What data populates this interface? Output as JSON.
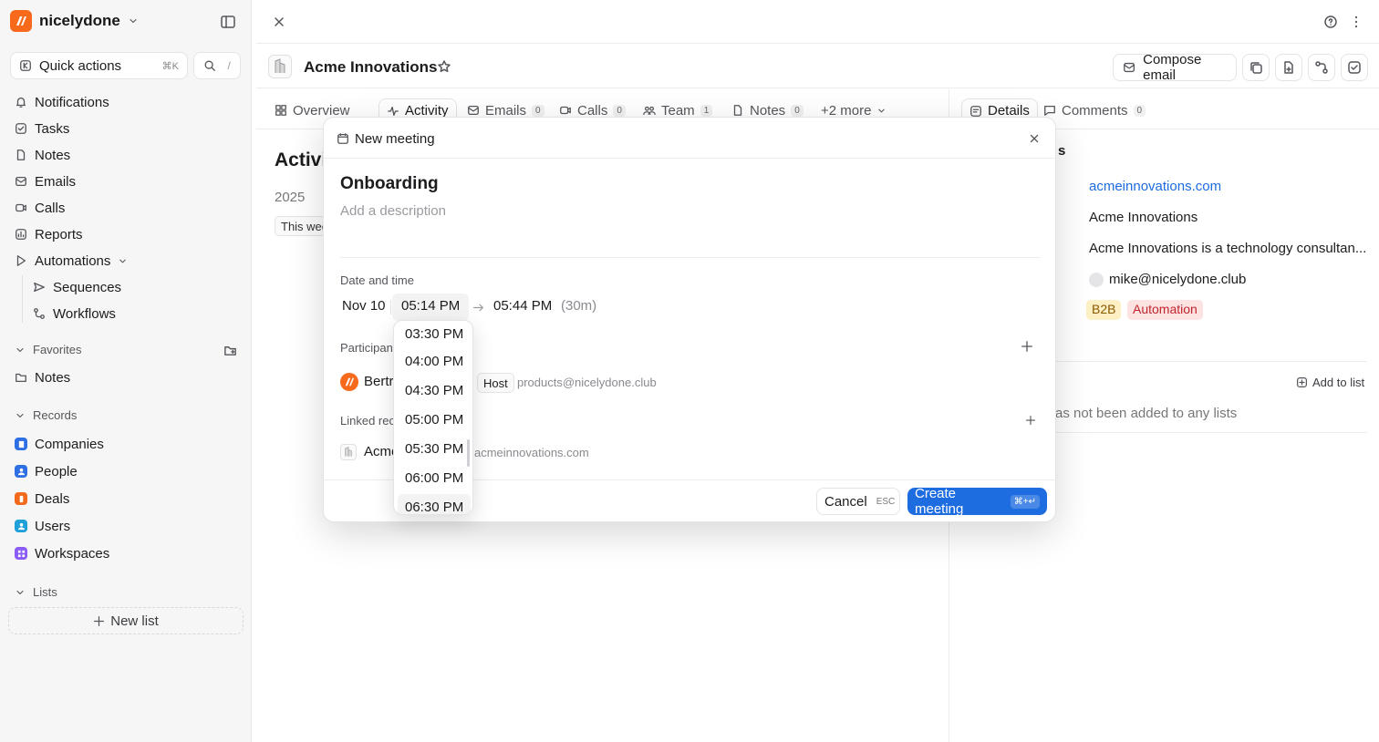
{
  "workspace": {
    "name": "nicelydone"
  },
  "sidebar": {
    "quick_actions": {
      "label": "Quick actions",
      "shortcut": "⌘K"
    },
    "search_shortcut": "/",
    "nav": [
      {
        "label": "Notifications",
        "icon": "bell-icon"
      },
      {
        "label": "Tasks",
        "icon": "check-square-icon"
      },
      {
        "label": "Notes",
        "icon": "note-icon"
      },
      {
        "label": "Emails",
        "icon": "mail-icon"
      },
      {
        "label": "Calls",
        "icon": "video-icon"
      },
      {
        "label": "Reports",
        "icon": "chart-icon"
      },
      {
        "label": "Automations",
        "icon": "play-icon"
      }
    ],
    "automations_children": [
      {
        "label": "Sequences"
      },
      {
        "label": "Workflows"
      }
    ],
    "favorites": {
      "label": "Favorites",
      "items": [
        {
          "label": "Notes"
        }
      ]
    },
    "records": {
      "label": "Records",
      "items": [
        {
          "label": "Companies",
          "color": "#2f6fe4"
        },
        {
          "label": "People",
          "color": "#2f6fe4"
        },
        {
          "label": "Deals",
          "color": "#f26b1d"
        },
        {
          "label": "Users",
          "color": "#1fa0d8"
        },
        {
          "label": "Workspaces",
          "color": "#8b5cf6"
        }
      ]
    },
    "lists": {
      "label": "Lists",
      "new_list": "New list"
    }
  },
  "record": {
    "name": "Acme Innovations",
    "compose_label": "Compose email",
    "tabs": [
      {
        "label": "Overview"
      },
      {
        "label": "Activity"
      },
      {
        "label": "Emails",
        "count": "0"
      },
      {
        "label": "Calls",
        "count": "0"
      },
      {
        "label": "Team",
        "count": "1"
      },
      {
        "label": "Notes",
        "count": "0"
      },
      {
        "label": "+2 more"
      }
    ],
    "side_tabs": [
      {
        "label": "Details"
      },
      {
        "label": "Comments",
        "count": "0"
      }
    ]
  },
  "activity": {
    "title": "Activi",
    "year": "2025",
    "week": "This wee"
  },
  "details": {
    "section_fragment": "s",
    "domain": "acmeinnovations.com",
    "name": "Acme Innovations",
    "description": "Acme Innovations is a technology consultan...",
    "email": "mike@nicelydone.club",
    "tags": [
      {
        "label": "B2B",
        "bg": "#fdf0c4",
        "fg": "#8a5a00"
      },
      {
        "label": "Automation",
        "bg": "#fde2e2",
        "fg": "#c0262d"
      }
    ],
    "add_to_list": "Add to list",
    "lists_empty": "as not been added to any lists"
  },
  "modal": {
    "title": "New meeting",
    "meeting_name": "Onboarding",
    "description_placeholder": "Add a description",
    "date_label": "Date and time",
    "date": "Nov 10",
    "start": "05:14 PM",
    "end": "05:44 PM",
    "duration": "(30m)",
    "participants_label": "Participant",
    "host_name": "Bertr",
    "host_tag": "Host",
    "host_email": "products@nicelydone.club",
    "linked_label": "Linked reco",
    "linked_name": "Acme",
    "linked_domain": "acmeinnovations.com",
    "cancel": "Cancel",
    "cancel_kbd": "ESC",
    "create": "Create meeting",
    "create_kbd": "⌘+↵"
  },
  "time_options": [
    "03:30 PM",
    "04:00 PM",
    "04:30 PM",
    "05:00 PM",
    "05:30 PM",
    "06:00 PM",
    "06:30 PM"
  ]
}
